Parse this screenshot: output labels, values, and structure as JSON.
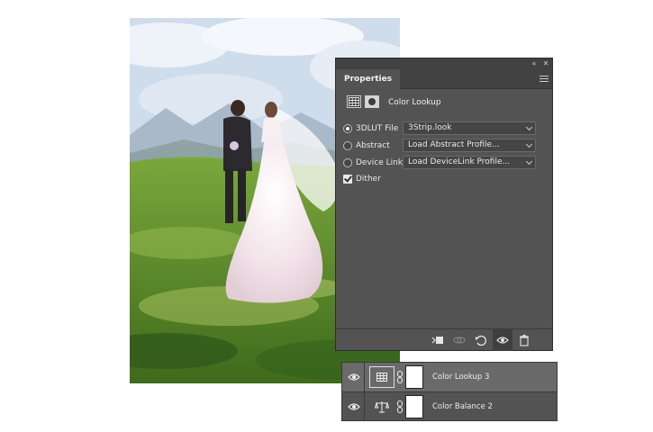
{
  "properties_panel": {
    "tab_label": "Properties",
    "title": "Color Lookup",
    "options": [
      {
        "label": "3DLUT File",
        "value": "3Strip.look",
        "selected": true
      },
      {
        "label": "Abstract",
        "value": "Load Abstract Profile...",
        "selected": false
      },
      {
        "label": "Device Link",
        "value": "Load DeviceLink Profile...",
        "selected": false
      }
    ],
    "dither": {
      "label": "Dither",
      "checked": true
    },
    "titlebar_icons": [
      "collapse-icon",
      "close-icon"
    ],
    "footer_icons": [
      "clip-to-layer-icon",
      "view-previous-state-icon",
      "reset-icon",
      "visibility-icon",
      "trash-icon"
    ]
  },
  "layers": [
    {
      "name": "Color Lookup 3",
      "selected": true,
      "icon": "color-lookup-icon"
    },
    {
      "name": "Color Balance 2",
      "selected": false,
      "icon": "color-balance-icon"
    }
  ],
  "colors": {
    "panel_bg": "#535353",
    "panel_dark": "#424242",
    "selected_layer": "#6a6a6a",
    "text": "#e6e6e6"
  }
}
